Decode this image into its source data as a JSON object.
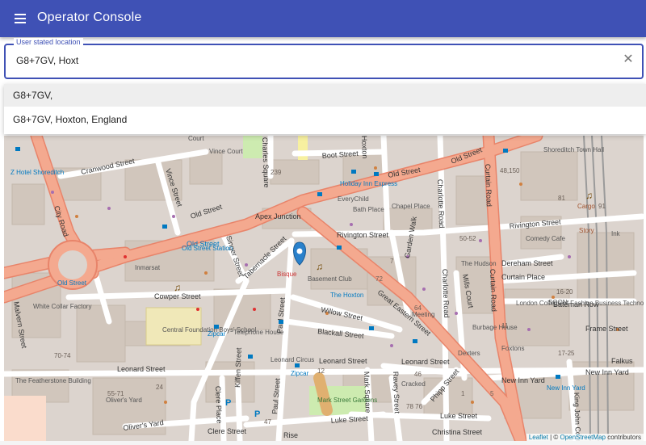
{
  "header": {
    "title": "Operator Console"
  },
  "location_field": {
    "label": "User stated location",
    "value": "G8+7GV, Hoxt"
  },
  "suggestions": [
    {
      "label": "G8+7GV,"
    },
    {
      "label": "G8+7GV, Hoxton, England"
    }
  ],
  "map": {
    "streets": {
      "old_street_1": "Old Street",
      "old_street_2": "Old Street",
      "old_street_3": "Old Street",
      "old_street_4": "Old Street",
      "city_road": "City Road",
      "cranwood_street": "Cranwood Street",
      "vince_street": "Vince Street",
      "singer_street": "Singer Street",
      "tabernacle_street": "Tabernacle Street",
      "paul_street_1": "Paul Street",
      "paul_street_2": "Paul Street",
      "rivington_street_1": "Rivington Street",
      "rivington_street_2": "Rivington Street",
      "great_eastern_street": "Great Eastern Street",
      "willow_street": "Willow Street",
      "blackall_street": "Blackall Street",
      "leonard_street_1": "Leonard Street",
      "leonard_street_2": "Leonard Street",
      "leonard_street_3": "Leonard Street",
      "cowper_street": "Cowper Street",
      "charlotte_road_1": "Charlotte Road",
      "charlotte_road_2": "Charlotte Road",
      "curtain_road_1": "Curtain Road",
      "curtain_road_2": "Curtain Road",
      "garden_walk": "Garden Walk",
      "mills_court": "Mills Court",
      "dereham_street": "Dereham Street",
      "curtain_place": "Curtain Place",
      "bateman_row": "Bateman Row",
      "new_inn_yard_1": "New Inn Yard",
      "new_inn_yard_2": "New Inn Yard",
      "luke_street_1": "Luke Street",
      "luke_street_2": "Luke Street",
      "christina_street": "Christina Street",
      "clere_street": "Clere Street",
      "olivers_yard": "Oliver's Yard",
      "boot_street": "Boot Street",
      "malvern_street": "Malvern Street",
      "clere_place": "Clere Place",
      "kiffen_street": "Kiffen Street",
      "mark_square": "Mark Square",
      "ravey_street": "Ravey Street",
      "phipp_street": "Phipp Street",
      "rise": "Rise",
      "king_john_court": "King John Court",
      "charles_square": "Charles Square",
      "hoxton": "Hoxton",
      "apex_junction": "Apex Junction",
      "frame_street": "Frame Street",
      "falkus": "Falkus"
    },
    "places": {
      "z_hotel": "Z Hotel Shoreditch",
      "old_street_station": "Old Street Station",
      "old_street_poi": "Old Street",
      "inmarsat": "Inmarsat",
      "white_collar_factory": "White Collar Factory",
      "central_foundation": "Central Foundation Boys' School",
      "telephone_house": "Telephone House",
      "zipcar_1": "Zipcar",
      "zipcar_2": "Zipcar",
      "leonard_circus": "Leonard Circus",
      "the_featherstone": "The Featherstone Building",
      "olivers_yard_poi": "Oliver's Yard",
      "holiday_inn": "Holiday Inn Express",
      "everychild": "EveryChild",
      "bath_place": "Bath Place",
      "chapel_place": "Chapel Place",
      "basement_club": "Basement Club",
      "the_hoxton": "The Hoxton",
      "meeting": "Meeting",
      "bisque": "Bisque",
      "dexters": "Dexters",
      "burbage_house": "Burbage House",
      "foxtons": "Foxtons",
      "comedy_cafe": "Comedy Cafe",
      "the_hudson": "The Hudson",
      "london_college": "London College of Fashion Business Technology Support Centre",
      "soon": "SOON",
      "shoreditch_town_hall": "Shoreditch Town Hall",
      "new_inn_yard_poi": "New Inn Yard",
      "cargo": "Cargo",
      "story": "Story",
      "ink": "Ink",
      "mark_street_gardens": "Mark Street Gardens",
      "cracked": "Cracked",
      "vince_court": "Vince Court",
      "court": "Court"
    },
    "numbers": [
      "239",
      "48,150",
      "81",
      "91",
      "50-52",
      "72",
      "7",
      "64",
      "11",
      "16-20",
      "17-25",
      "70-74",
      "55-71",
      "24",
      "47",
      "78 76",
      "12",
      "46",
      "1",
      "5"
    ],
    "attribution": {
      "leaflet": "Leaflet",
      "sep": " | © ",
      "osm": "OpenStreetMap",
      "suffix": " contributors"
    },
    "colors": {
      "land": "#dcd4ce",
      "building": "#d1c6bc",
      "primary_road": "#fcd6a4",
      "trunk_road": "#f4a98f",
      "trunk_casing": "#e8846a",
      "park": "#cdebb0",
      "school": "#f0e8b8",
      "marker": "#2a81cb"
    }
  }
}
